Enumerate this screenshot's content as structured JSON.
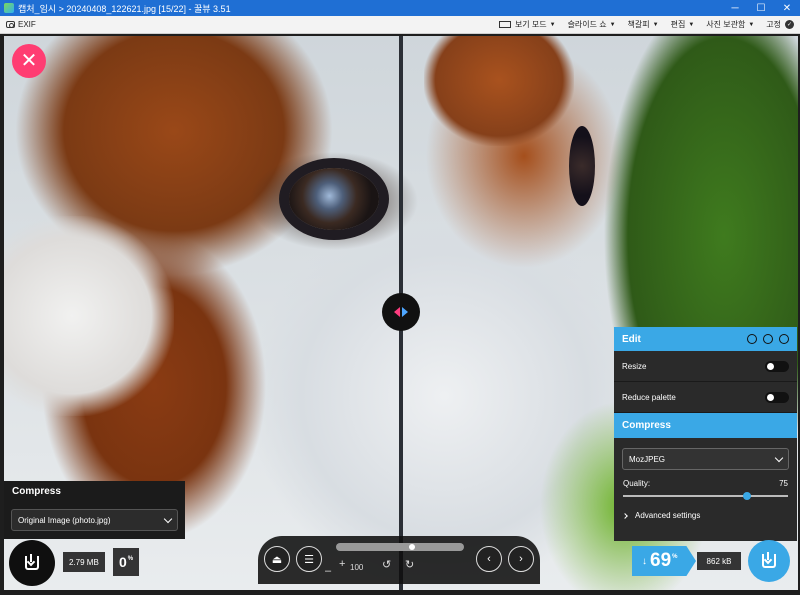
{
  "window": {
    "title": "캡처_임시 > 20240408_122621.jpg [15/22] - 꿀뷰 3.51",
    "minimize": "─",
    "maximize": "☐",
    "close": "✕"
  },
  "toolbar": {
    "exif": "EXIF",
    "menus": [
      "보기 모드",
      "슬라이드 쇼",
      "책갈피",
      "편집",
      "사진 보관함"
    ],
    "pin": "고정"
  },
  "left_panel": {
    "title": "Compress",
    "selected": "Original Image (photo.jpg)",
    "size": "2.79 MB",
    "percent": "0",
    "percent_unit": "%"
  },
  "bottom_bar": {
    "zoom_level": 0.6,
    "minus": "–",
    "plus": "+",
    "zoom_text": "100",
    "rotate_left": "↺",
    "rotate_right": "↻",
    "eject": "⏏",
    "menu": "☰",
    "prev": "‹",
    "next": "›"
  },
  "edit_panel": {
    "title": "Edit",
    "resize": "Resize",
    "resize_on": false,
    "reduce_palette": "Reduce palette",
    "reduce_palette_on": false,
    "compress_title": "Compress",
    "codec": "MozJPEG",
    "quality_label": "Quality:",
    "quality_value": "75",
    "advanced": "Advanced settings"
  },
  "result": {
    "arrow": "↓",
    "percent": "69",
    "percent_unit": "%",
    "size": "862 kB"
  },
  "colors": {
    "accent": "#3aa8e6",
    "close": "#ff3d72",
    "titlebar": "#1f6fd4"
  }
}
